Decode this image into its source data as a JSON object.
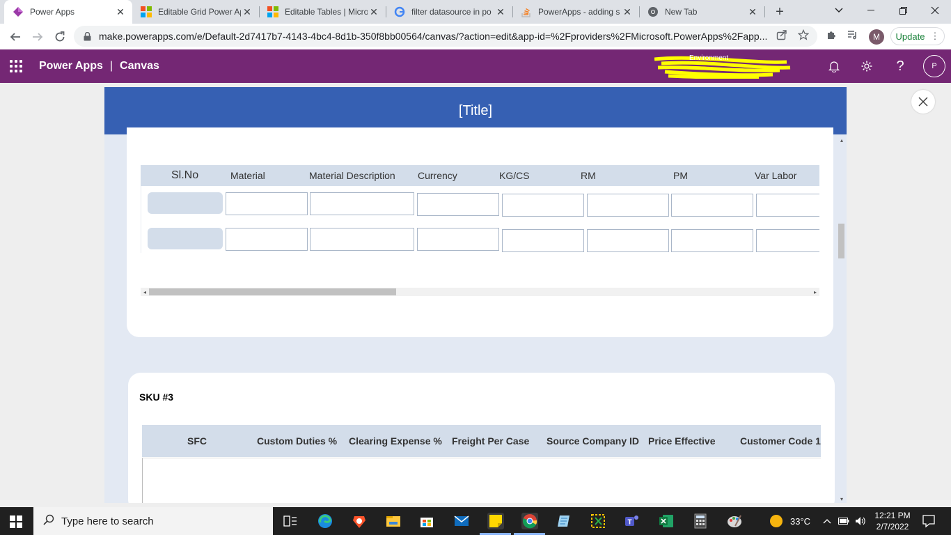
{
  "browser": {
    "tabs": [
      {
        "title": "Power Apps",
        "active": true,
        "icon": "powerapps-icon"
      },
      {
        "title": "Editable Grid Power Ap",
        "active": false,
        "icon": "microsoft-icon"
      },
      {
        "title": "Editable Tables | Micro",
        "active": false,
        "icon": "microsoft-icon"
      },
      {
        "title": "filter datasource in po",
        "active": false,
        "icon": "google-icon"
      },
      {
        "title": "PowerApps - adding s",
        "active": false,
        "icon": "stackoverflow-icon"
      },
      {
        "title": "New Tab",
        "active": false,
        "icon": "chrome-icon"
      }
    ],
    "url": "make.powerapps.com/e/Default-2d7417b7-4143-4bc4-8d1b-350f8bb00564/canvas/?action=edit&app-id=%2Fproviders%2FMicrosoft.PowerApps%2Fapp...",
    "profile_initial": "M",
    "update_label": "Update"
  },
  "powerapps": {
    "product": "Power Apps",
    "mode": "Canvas",
    "environment_label": "Environment",
    "user_initial": "P"
  },
  "app": {
    "title": "[Title]",
    "grid1": {
      "columns": [
        "Sl.No",
        "Material",
        "Material Description",
        "Currency",
        "KG/CS",
        "RM",
        "PM",
        "Var Labor"
      ],
      "rows": [
        {
          "sl": "",
          "values": [
            "",
            "",
            "",
            "",
            "",
            "",
            ""
          ]
        },
        {
          "sl": "",
          "values": [
            "",
            "",
            "",
            "",
            "",
            "",
            ""
          ]
        }
      ]
    },
    "sku_title": "SKU #3",
    "grid2": {
      "columns": [
        "SFC",
        "Custom Duties %",
        "Clearing Expense %",
        "Freight Per Case",
        "Source Company ID",
        "Price Effective",
        "Customer Code 1"
      ]
    }
  },
  "taskbar": {
    "search_placeholder": "Type here to search",
    "temperature": "33°C",
    "time": "12:21 PM",
    "date": "2/7/2022"
  },
  "colors": {
    "powerapps_header": "#742774",
    "app_title_bar": "#3660b3",
    "grid_header": "#d3ddea",
    "update_green": "#188038"
  }
}
